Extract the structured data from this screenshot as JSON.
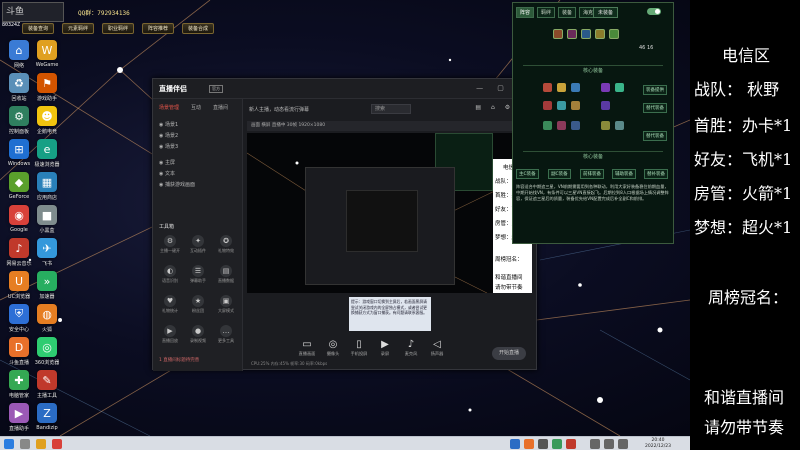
{
  "topbar": {
    "logo_text": "斗鱼",
    "qq_label": "QQ群：792934136",
    "user_tag": "80324Z",
    "buttons": [
      "装备查询",
      "元素羁绊",
      "职业羁绊",
      "阵容推荐",
      "装备合成"
    ]
  },
  "desktop_icons": [
    {
      "label": "网络",
      "icon": "network-icon",
      "color": "#3a7bd5"
    },
    {
      "label": "回收站",
      "icon": "recycle-bin-icon",
      "color": "#5a8fb8"
    },
    {
      "label": "控制面板",
      "icon": "control-panel-icon",
      "color": "#2f7f5f"
    },
    {
      "label": "Windows",
      "icon": "windows-icon",
      "color": "#1f6fd1"
    },
    {
      "label": "GeForce",
      "icon": "nvidia-icon",
      "color": "#5aa02c"
    },
    {
      "label": "Google",
      "icon": "chrome-icon",
      "color": "#d8413a"
    },
    {
      "label": "网易云音乐",
      "icon": "music-icon",
      "color": "#c0392b"
    },
    {
      "label": "UC浏览器",
      "icon": "uc-browser-icon",
      "color": "#e67e22"
    },
    {
      "label": "安全中心",
      "icon": "shield-icon",
      "color": "#2d6fd6"
    },
    {
      "label": "斗鱼直播",
      "icon": "douyu-icon",
      "color": "#e8702a"
    },
    {
      "label": "电脑管家",
      "icon": "manager-icon",
      "color": "#34a853"
    },
    {
      "label": "直播助手",
      "icon": "live-icon",
      "color": "#9b59b6"
    },
    {
      "label": "WeGame",
      "icon": "wegame-icon",
      "color": "#e0a020"
    },
    {
      "label": "游戏助手",
      "icon": "game-icon",
      "color": "#d35400"
    },
    {
      "label": "企鹅电竞",
      "icon": "penguin-icon",
      "color": "#f1c40f"
    },
    {
      "label": "极速浏览器",
      "icon": "browser-icon",
      "color": "#16a085"
    },
    {
      "label": "应用商店",
      "icon": "store-icon",
      "color": "#2980b9"
    },
    {
      "label": "小黑盒",
      "icon": "box-icon",
      "color": "#7f8c8d"
    },
    {
      "label": "飞书",
      "icon": "feishu-icon",
      "color": "#3498db"
    },
    {
      "label": "加速器",
      "icon": "accelerator-icon",
      "color": "#27ae60"
    },
    {
      "label": "火狐",
      "icon": "firefox-icon",
      "color": "#e67e22"
    },
    {
      "label": "360浏览器",
      "icon": "browser-360-icon",
      "color": "#2ecc71"
    },
    {
      "label": "主播工具",
      "icon": "tool-icon",
      "color": "#c0392b"
    },
    {
      "label": "Bandizip",
      "icon": "bandizip-icon",
      "color": "#2b6cc4"
    }
  ],
  "game_panel": {
    "tabs": [
      "阵容",
      "羁绊",
      "装备",
      "海克斯"
    ],
    "select_label": "未装备",
    "stat_text": "46  16",
    "section1": "核心装备",
    "section2": "核心装备",
    "role_labels": [
      "装备提供",
      "替代装备",
      "替代装备"
    ],
    "bottom_buttons": [
      "主C装备",
      "副C装备",
      "前排装备",
      "辅助装备",
      "替补装备"
    ],
    "description": "阵容适合中期追三星，VN前期需要用到各种联动，利用大家好装备稳住前期血量，中期开始找VN，有条件可以三星VN直接起飞。后期拉到8人口根据场上情况调整阵容，保证追三星后的质量，装备优先给VN配置完成后补全副C和前排。"
  },
  "overlay": {
    "region": "电信区",
    "line1": "战队：  秋野",
    "line2": "首胜：办卡*1",
    "line3": "好友：飞机*1",
    "line4": "房管：火箭*1",
    "line5": "梦想：超火*1",
    "weekly": "周榜冠名：",
    "footer1": "和谐直播间",
    "footer2": "请勿带节奏"
  },
  "app": {
    "title": "直播伴侣",
    "version": "官方",
    "left_tabs": [
      "场景管理",
      "互动",
      "直播间"
    ],
    "scene_rows": [
      "场景1",
      "场景2",
      "场景3",
      "主屏",
      "文本",
      "捕获游戏画面"
    ],
    "tools_title": "工具箱",
    "tools": [
      {
        "label": "主播一键开",
        "icon": "⚙"
      },
      {
        "label": "互动插件",
        "icon": "✦"
      },
      {
        "label": "礼物特效",
        "icon": "✪"
      },
      {
        "label": "语音识别",
        "icon": "◐"
      },
      {
        "label": "弹幕助手",
        "icon": "☰"
      },
      {
        "label": "直播数据",
        "icon": "▤"
      },
      {
        "label": "礼物统计",
        "icon": "♥"
      },
      {
        "label": "粉丝团",
        "icon": "★"
      },
      {
        "label": "大屏模式",
        "icon": "▣"
      },
      {
        "label": "直播回放",
        "icon": "▶"
      },
      {
        "label": "录制视频",
        "icon": "●"
      },
      {
        "label": "更多工具",
        "icon": "…"
      }
    ],
    "left_footer": "1 直播间标题待完善",
    "notice": "新人主播，动态看流行弹幕",
    "search_placeholder": "搜索",
    "preview_bar": "画面  横屏  直播中  30帧  1920×1080",
    "tip_text": "提示：游戏窗口切换到主屏后，若画面黑屏请尝试关闭游戏内的全屏独占模式，或者尝试更换捕获方式为窗口捕获。有问题请联系客服。",
    "bottom_buttons": [
      {
        "label": "直播画面",
        "icon": "▭"
      },
      {
        "label": "摄像头",
        "icon": "◎"
      },
      {
        "label": "手机投屏",
        "icon": "▯"
      },
      {
        "label": "录屏",
        "icon": "▶"
      },
      {
        "label": "麦克风",
        "icon": "♪"
      },
      {
        "label": "扬声器",
        "icon": "◁"
      }
    ],
    "start_label": "开始直播",
    "stats_line": "CPU:25%  内存:45%  帧率:30  码率:0kbps"
  },
  "taskbar": {
    "time": "20:40",
    "date": "2022/12/23"
  }
}
